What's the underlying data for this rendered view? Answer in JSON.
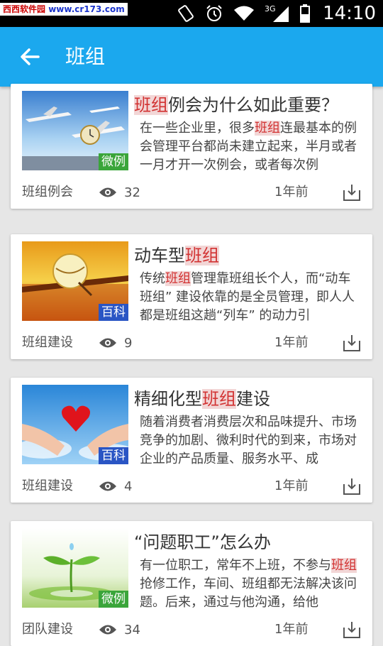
{
  "watermark": {
    "left": "西西软件园",
    "site": "www.cr173.com"
  },
  "status": {
    "time": "14:10",
    "network": "3G"
  },
  "appbar": {
    "title": "班组"
  },
  "articles": [
    {
      "title_pre": "",
      "title_hl": "班组",
      "title_post": "例会为什么如此重要？",
      "sum_pre": "在一些企业里，很多",
      "sum_hl": "班组",
      "sum_post": "连最基本的例会管理平台都尚未建立起来，半月或者一月才开一次例会，或者每次例",
      "badge": "微例",
      "tag": "班组例会",
      "views": "32",
      "time": "1年前"
    },
    {
      "title_pre": "动车型",
      "title_hl": "班组",
      "title_post": "",
      "sum_pre": "传统",
      "sum_hl": "班组",
      "sum_post": "管理靠班组长个人，而“动车班组” 建设依靠的是全员管理，即人人都是班组这趟“列车” 的动力引",
      "badge": "百科",
      "tag": "班组建设",
      "views": "9",
      "time": "1年前"
    },
    {
      "title_pre": "精细化型",
      "title_hl": "班组",
      "title_post": "建设",
      "sum_pre": "随着消费者消费层次和品味提升、市场竞争的加剧、微利时代的到来，市场对企业的产品质量、服务水平、成",
      "sum_hl": "",
      "sum_post": "",
      "badge": "百科",
      "tag": "班组建设",
      "views": "4",
      "time": "1年前"
    },
    {
      "title_pre": "“问题职工”怎么办",
      "title_hl": "",
      "title_post": "",
      "sum_pre": "有一位职工，常年不上班，不参与",
      "sum_hl": "班组",
      "sum_post": "抢修工作，车间、班组都无法解决该问题。后来，通过与他沟通，给他",
      "badge": "微例",
      "tag": "团队建设",
      "views": "34",
      "time": "1年前"
    }
  ],
  "colors": {
    "appbar": "#1ba8ee",
    "highlight_text": "#d23232",
    "highlight_bg": "#f2d6d6",
    "badge_green": "#3aa53a",
    "badge_blue": "#2a55c4"
  },
  "icons": {
    "back": "arrow-left-icon",
    "views": "eye-icon",
    "download": "download-icon"
  }
}
